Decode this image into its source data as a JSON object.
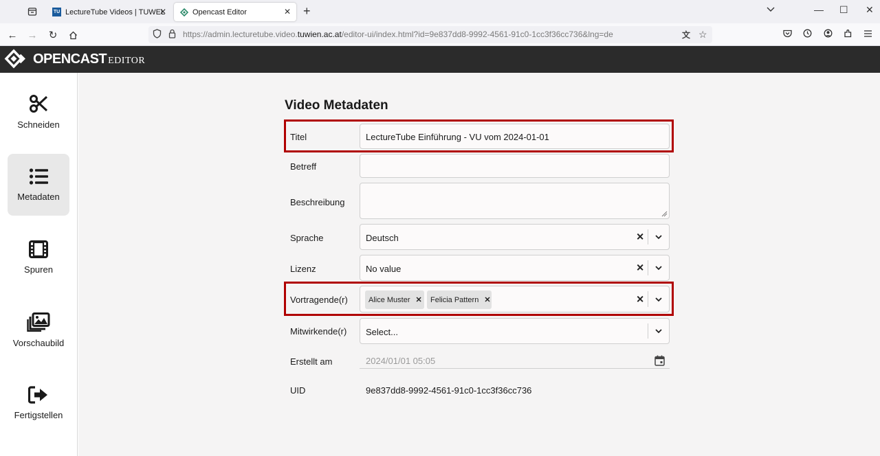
{
  "browser": {
    "tabs": [
      {
        "label": "LectureTube Videos | TUWEL",
        "favicon": "TU"
      },
      {
        "label": "Opencast Editor"
      }
    ],
    "url_prefix": "https://admin.lecturetube.video.",
    "url_domain": "tuwien.ac.at",
    "url_suffix": "/editor-ui/index.html?id=9e837dd8-9992-4561-91c0-1cc3f36cc736&lng=de"
  },
  "app": {
    "logo_main": "OPENCAST",
    "logo_sub": "EDITOR"
  },
  "sidebar": {
    "items": [
      {
        "label": "Schneiden",
        "icon": "scissors-icon"
      },
      {
        "label": "Metadaten",
        "icon": "list-icon"
      },
      {
        "label": "Spuren",
        "icon": "film-icon"
      },
      {
        "label": "Vorschaubild",
        "icon": "images-icon"
      },
      {
        "label": "Fertigstellen",
        "icon": "sign-out-icon"
      }
    ]
  },
  "main": {
    "title": "Video Metadaten",
    "fields": {
      "titel_label": "Titel",
      "titel_value": "LectureTube Einführung - VU vom 2024-01-01",
      "betreff_label": "Betreff",
      "betreff_value": "",
      "beschreibung_label": "Beschreibung",
      "beschreibung_value": "",
      "sprache_label": "Sprache",
      "sprache_value": "Deutsch",
      "lizenz_label": "Lizenz",
      "lizenz_value": "No value",
      "vortragende_label": "Vortragende(r)",
      "vortragende_chips": [
        "Alice Muster",
        "Felicia Pattern"
      ],
      "mitwirkende_label": "Mitwirkende(r)",
      "mitwirkende_placeholder": "Select...",
      "erstellt_label": "Erstellt am",
      "erstellt_value": "2024/01/01 05:05",
      "uid_label": "UID",
      "uid_value": "9e837dd8-9992-4561-91c0-1cc3f36cc736"
    }
  },
  "colors": {
    "highlight": "#b00000",
    "header_bg": "#2b2b2b",
    "main_bg": "#f5f4f4"
  }
}
